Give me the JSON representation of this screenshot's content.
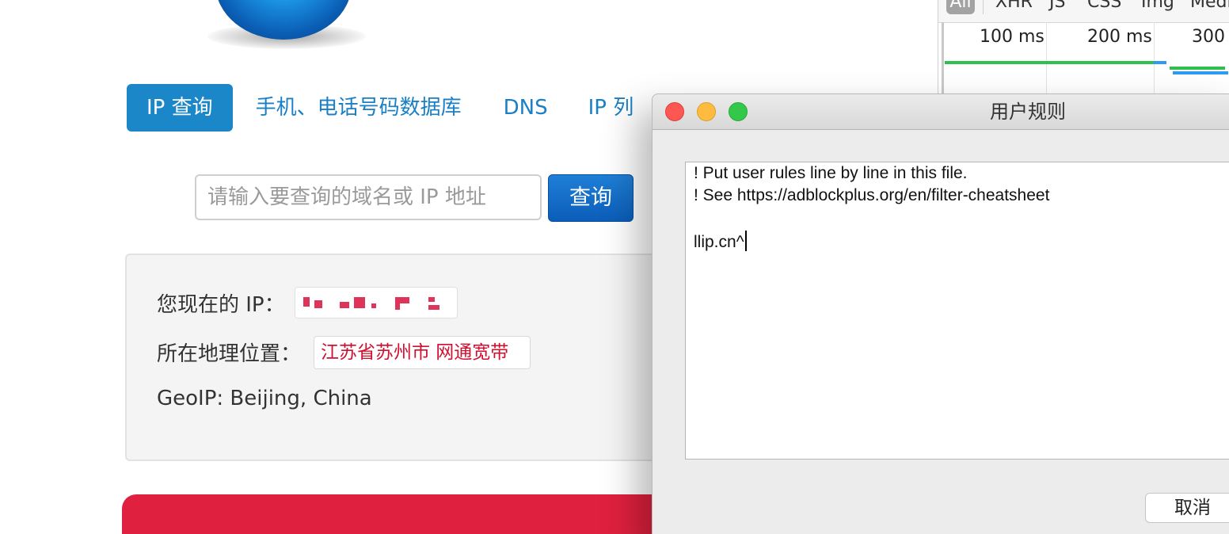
{
  "site": {
    "nav": {
      "items": [
        {
          "label": "IP 查询",
          "active": true
        },
        {
          "label": "手机、电话号码数据库"
        },
        {
          "label": "DNS"
        },
        {
          "label": "IP 列"
        }
      ]
    },
    "search": {
      "placeholder": "请输入要查询的域名或 IP 地址",
      "button_label": "查询"
    },
    "info": {
      "current_ip_label": "您现在的 IP：",
      "location_label": "所在地理位置：",
      "location_value": "江苏省苏州市  网通宽带",
      "geoip_text": "GeoIP: Beijing, China"
    },
    "colors": {
      "accent": "#1b86c8",
      "location_text": "#d0102e",
      "band": "#e0203f"
    }
  },
  "devtools": {
    "filters": [
      "All",
      "XHR",
      "JS",
      "CSS",
      "Img",
      "Medi"
    ],
    "timeline_ticks": [
      "100 ms",
      "200 ms",
      "300"
    ]
  },
  "dialog": {
    "title": "用户规则",
    "editor_lines": [
      "! Put user rules line by line in this file.",
      "! See https://adblockplus.org/en/filter-cheatsheet",
      "",
      "llip.cn^"
    ],
    "cancel_label": "取消"
  }
}
